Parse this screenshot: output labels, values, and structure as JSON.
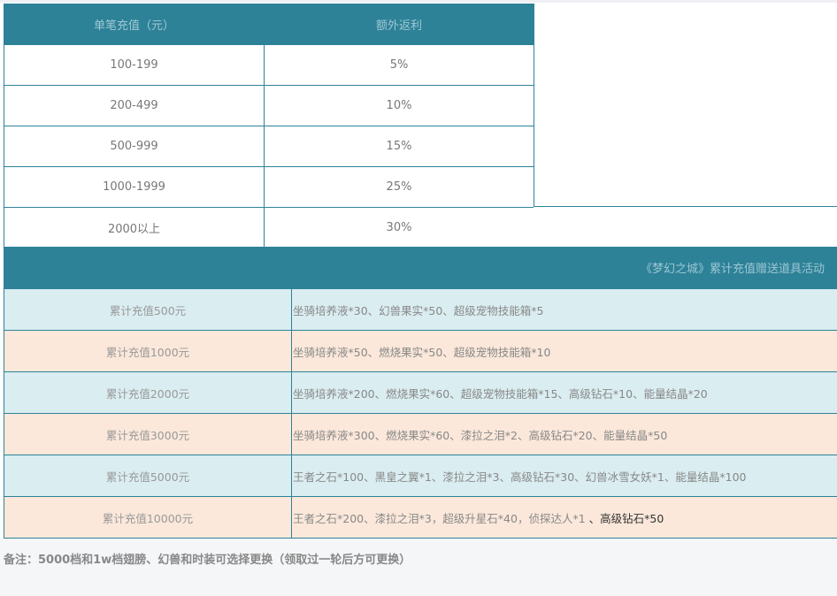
{
  "rebate_table": {
    "headers": [
      "单笔充值（元）",
      "额外返利"
    ],
    "rows": [
      {
        "amount": "100-199",
        "bonus": "5%"
      },
      {
        "amount": "200-499",
        "bonus": "10%"
      },
      {
        "amount": "500-999",
        "bonus": "15%"
      },
      {
        "amount": "1000-1999",
        "bonus": "25%"
      },
      {
        "amount": "2000以上",
        "bonus": "30%"
      }
    ]
  },
  "cumulative": {
    "title": "《梦幻之城》累计充值赠送道具活动",
    "rows": [
      {
        "level": "累计充值500元",
        "rewards": "坐骑培养液*30、幻兽果实*50、超级宠物技能箱*5",
        "extra": ""
      },
      {
        "level": "累计充值1000元",
        "rewards": "坐骑培养液*50、燃烧果实*50、超级宠物技能箱*10",
        "extra": ""
      },
      {
        "level": "累计充值2000元",
        "rewards": "坐骑培养液*200、燃烧果实*60、超级宠物技能箱*15、高级钻石*10、能量结晶*20",
        "extra": ""
      },
      {
        "level": "累计充值3000元",
        "rewards": "坐骑培养液*300、燃烧果实*60、漆拉之泪*2、高级钻石*20、能量结晶*50",
        "extra": ""
      },
      {
        "level": "累计充值5000元",
        "rewards": "王者之石*100、黑皇之翼*1、漆拉之泪*3、高级钻石*30、幻兽冰雪女妖*1、能量结晶*100",
        "extra": ""
      },
      {
        "level": "累计充值10000元",
        "rewards": "王者之石*200、漆拉之泪*3，超级升星石*40，侦探达人*1 ",
        "extra": "、高级钻石*50"
      }
    ]
  },
  "note": "备注：5000档和1w档翅膀、幻兽和时装可选择更换（领取过一轮后方可更换）"
}
